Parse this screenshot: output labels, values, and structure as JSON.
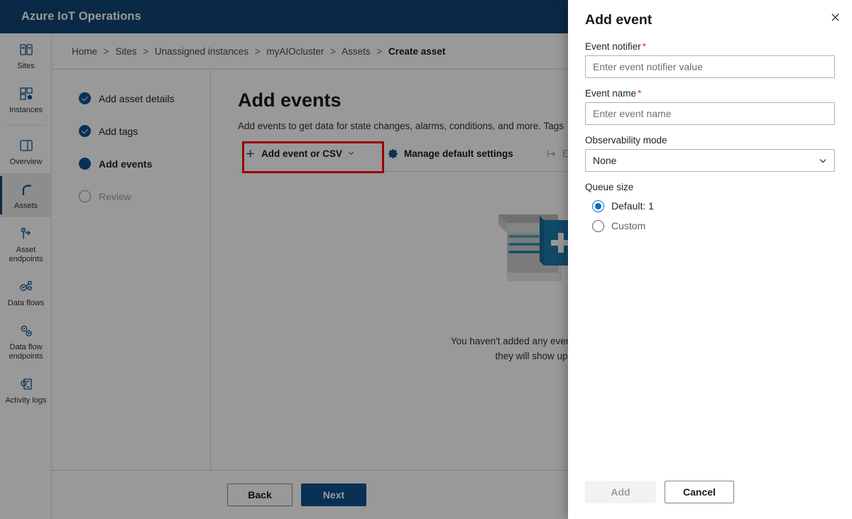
{
  "colors": {
    "brand_header": "#0f4576",
    "accent": "#10538f",
    "required_asterisk": "#d13438",
    "highlight_box": "#ff0000",
    "radio_selected": "#0f6cbd"
  },
  "app": {
    "title": "Azure IoT Operations"
  },
  "sidebar": {
    "items": [
      {
        "label": "Sites",
        "icon": "sites-icon",
        "selected": false
      },
      {
        "label": "Instances",
        "icon": "instances-icon",
        "selected": false
      },
      {
        "label": "Overview",
        "icon": "overview-icon",
        "selected": false
      },
      {
        "label": "Assets",
        "icon": "assets-icon",
        "selected": true
      },
      {
        "label": "Asset endpoints",
        "icon": "asset-endpoints-icon",
        "selected": false
      },
      {
        "label": "Data flows",
        "icon": "data-flows-icon",
        "selected": false
      },
      {
        "label": "Data flow endpoints",
        "icon": "data-flow-endpoints-icon",
        "selected": false
      },
      {
        "label": "Activity logs",
        "icon": "activity-logs-icon",
        "selected": false
      }
    ]
  },
  "breadcrumb": {
    "separator": ">",
    "items": [
      {
        "label": "Home",
        "current": false
      },
      {
        "label": "Sites",
        "current": false
      },
      {
        "label": "Unassigned instances",
        "current": false
      },
      {
        "label": "myAIOcluster",
        "current": false
      },
      {
        "label": "Assets",
        "current": false
      },
      {
        "label": "Create asset",
        "current": true
      }
    ]
  },
  "wizard": {
    "steps": [
      {
        "label": "Add asset details",
        "state": "done"
      },
      {
        "label": "Add tags",
        "state": "done"
      },
      {
        "label": "Add events",
        "state": "current"
      },
      {
        "label": "Review",
        "state": "todo"
      }
    ],
    "back_label": "Back",
    "next_label": "Next"
  },
  "main": {
    "title": "Add events",
    "description": "Add events to get data for state changes, alarms, conditions, and more. Tags",
    "toolbar": {
      "add_event_label": "Add event or CSV",
      "add_event_icon": "plus-icon",
      "add_event_chevron": "chevron-down-icon",
      "manage_settings_label": "Manage default settings",
      "manage_settings_icon": "gear-icon",
      "export_label": "Ex",
      "export_icon": "export-icon"
    },
    "empty_state": {
      "illustration": "add-document-illustration",
      "line1": "You haven't added any events yet. On",
      "line2": "they will show up"
    }
  },
  "panel": {
    "title": "Add event",
    "close_icon": "close-icon",
    "fields": {
      "event_notifier": {
        "label": "Event notifier",
        "required": true,
        "value": "",
        "placeholder": "Enter event notifier value"
      },
      "event_name": {
        "label": "Event name",
        "required": true,
        "value": "",
        "placeholder": "Enter event name"
      },
      "observability_mode": {
        "label": "Observability mode",
        "selected": "None",
        "chevron_icon": "chevron-down-icon",
        "options": [
          "None"
        ]
      },
      "queue_size": {
        "label": "Queue size",
        "options": [
          {
            "label": "Default: 1",
            "checked": true
          },
          {
            "label": "Custom",
            "checked": false
          }
        ]
      }
    },
    "footer": {
      "add_label": "Add",
      "add_disabled": true,
      "cancel_label": "Cancel"
    }
  }
}
